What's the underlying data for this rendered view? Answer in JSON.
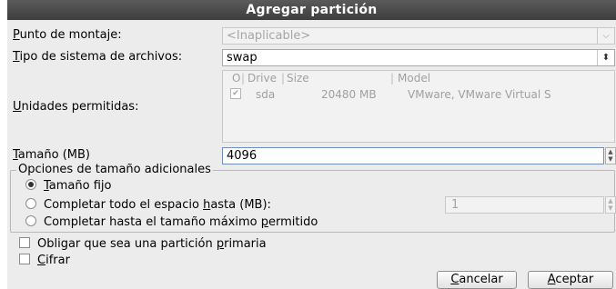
{
  "window": {
    "title": "Agregar partición"
  },
  "mount_point": {
    "label_key": "P",
    "label_rest": "unto de montaje:",
    "value": "<Inaplicable>",
    "arrow_icon": "chevron-down"
  },
  "fs_type": {
    "label_key": "T",
    "label_rest": "ipo de sistema de archivos:",
    "value": "swap",
    "arrow_icon": "updown-arrows"
  },
  "drives": {
    "label_key": "U",
    "label_rest": "nidades permitidas:",
    "headers": {
      "check": "O",
      "drive": "Drive",
      "size": "Size",
      "model": "Model"
    },
    "rows": [
      {
        "checked": true,
        "drive": "sda",
        "size": "20480 MB",
        "model": "VMware, VMware Virtual S"
      }
    ]
  },
  "size": {
    "label_key": "T",
    "label_rest": "amaño (MB)",
    "value": "4096"
  },
  "size_options": {
    "title": "Opciones de tamaño adicionales",
    "fixed": {
      "key": "T",
      "rest": "amaño fijo",
      "selected": true
    },
    "fill_up_to": {
      "before": "Completar todo el espacio ",
      "key": "h",
      "after": "asta (MB):",
      "selected": false,
      "value": "1"
    },
    "fill_max": {
      "before": "Completar hasta el tamaño máximo ",
      "key": "p",
      "after": "ermitido",
      "selected": false
    }
  },
  "primary": {
    "before": "Obligar que sea una partición ",
    "key": "p",
    "after": "rimaria",
    "checked": false
  },
  "encrypt": {
    "key": "C",
    "rest": "ifrar",
    "checked": false
  },
  "buttons": {
    "cancel": {
      "key": "C",
      "rest": "ancelar"
    },
    "accept": {
      "key": "A",
      "rest": "ceptar"
    }
  }
}
